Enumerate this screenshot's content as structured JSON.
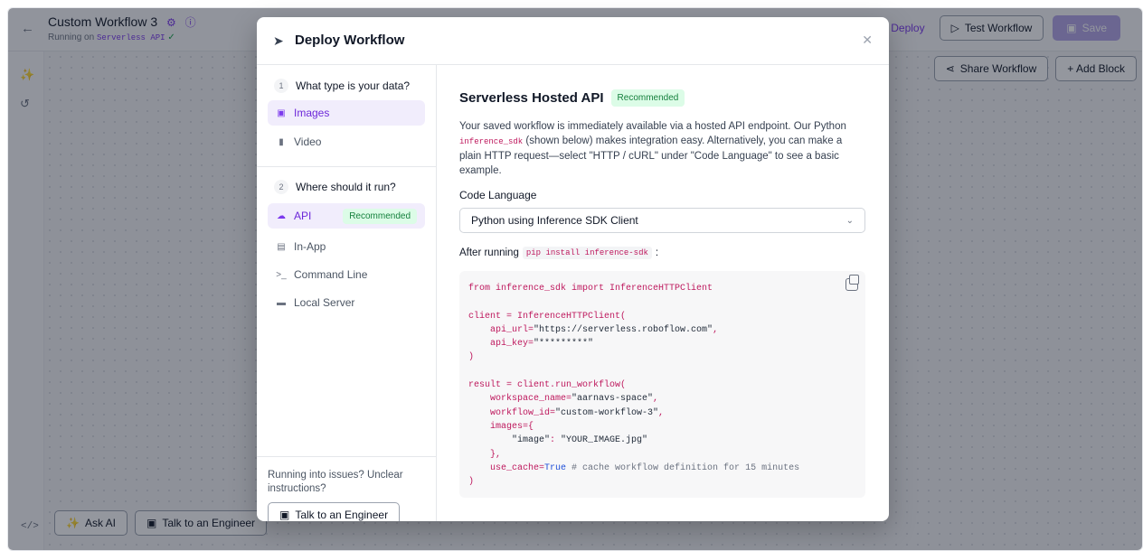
{
  "header": {
    "back_icon": "arrow-left-icon",
    "title": "Custom Workflow 3",
    "subtitle_prefix": "Running on",
    "subtitle_env": "Serverless API",
    "deploy_label": "Deploy",
    "test_label": "Test Workflow",
    "save_label": "Save"
  },
  "canvas": {
    "share_label": "Share Workflow",
    "add_block_label": "+ Add Block",
    "ask_ai_label": "Ask AI",
    "talk_label": "Talk to an Engineer",
    "code_toggle": "</>"
  },
  "modal": {
    "title": "Deploy Workflow",
    "steps": [
      {
        "num": "1",
        "label": "What type is your data?"
      },
      {
        "num": "2",
        "label": "Where should it run?"
      }
    ],
    "data_types": [
      {
        "label": "Images",
        "selected": true,
        "icon": "image-icon"
      },
      {
        "label": "Video",
        "selected": false,
        "icon": "video-icon"
      }
    ],
    "run_targets": [
      {
        "label": "API",
        "selected": true,
        "badge": "Recommended",
        "icon": "cloud-icon"
      },
      {
        "label": "In-App",
        "selected": false,
        "icon": "app-icon"
      },
      {
        "label": "Command Line",
        "selected": false,
        "icon": "terminal-icon"
      },
      {
        "label": "Local Server",
        "selected": false,
        "icon": "laptop-icon"
      }
    ],
    "help_text": "Running into issues? Unclear instructions?",
    "help_button": "Talk to an Engineer",
    "main": {
      "title": "Serverless Hosted API",
      "badge": "Recommended",
      "desc_part1": "Your saved workflow is immediately available via a hosted API endpoint. Our Python",
      "desc_code": "inference_sdk",
      "desc_part2": "(shown below) makes integration easy. Alternatively, you can make a plain HTTP request—select \"HTTP / cURL\" under \"Code Language\" to see a basic example.",
      "code_language_label": "Code Language",
      "code_language_value": "Python using Inference SDK Client",
      "after_running": "After running",
      "pip_command": "pip install inference-sdk",
      "after_colon": ":",
      "code": {
        "l1": "from inference_sdk import InferenceHTTPClient",
        "l3": "client = InferenceHTTPClient(",
        "l4a": "    api_url=",
        "l4b": "\"https://serverless.roboflow.com\"",
        "l4c": ",",
        "l5a": "    api_key=",
        "l5b": "\"*********\"",
        "l6": ")",
        "l8": "result = client.run_workflow(",
        "l9a": "    workspace_name=",
        "l9b": "\"aarnavs-space\"",
        "l9c": ",",
        "l10a": "    workflow_id=",
        "l10b": "\"custom-workflow-3\"",
        "l10c": ",",
        "l11": "    images={",
        "l12a": "        ",
        "l12b": "\"image\"",
        "l12c": ": ",
        "l12d": "\"YOUR_IMAGE.jpg\"",
        "l13": "    },",
        "l14a": "    use_cache=",
        "l14b": "True",
        "l14c": " # cache workflow definition for 15 minutes",
        "l15": ")"
      }
    }
  }
}
